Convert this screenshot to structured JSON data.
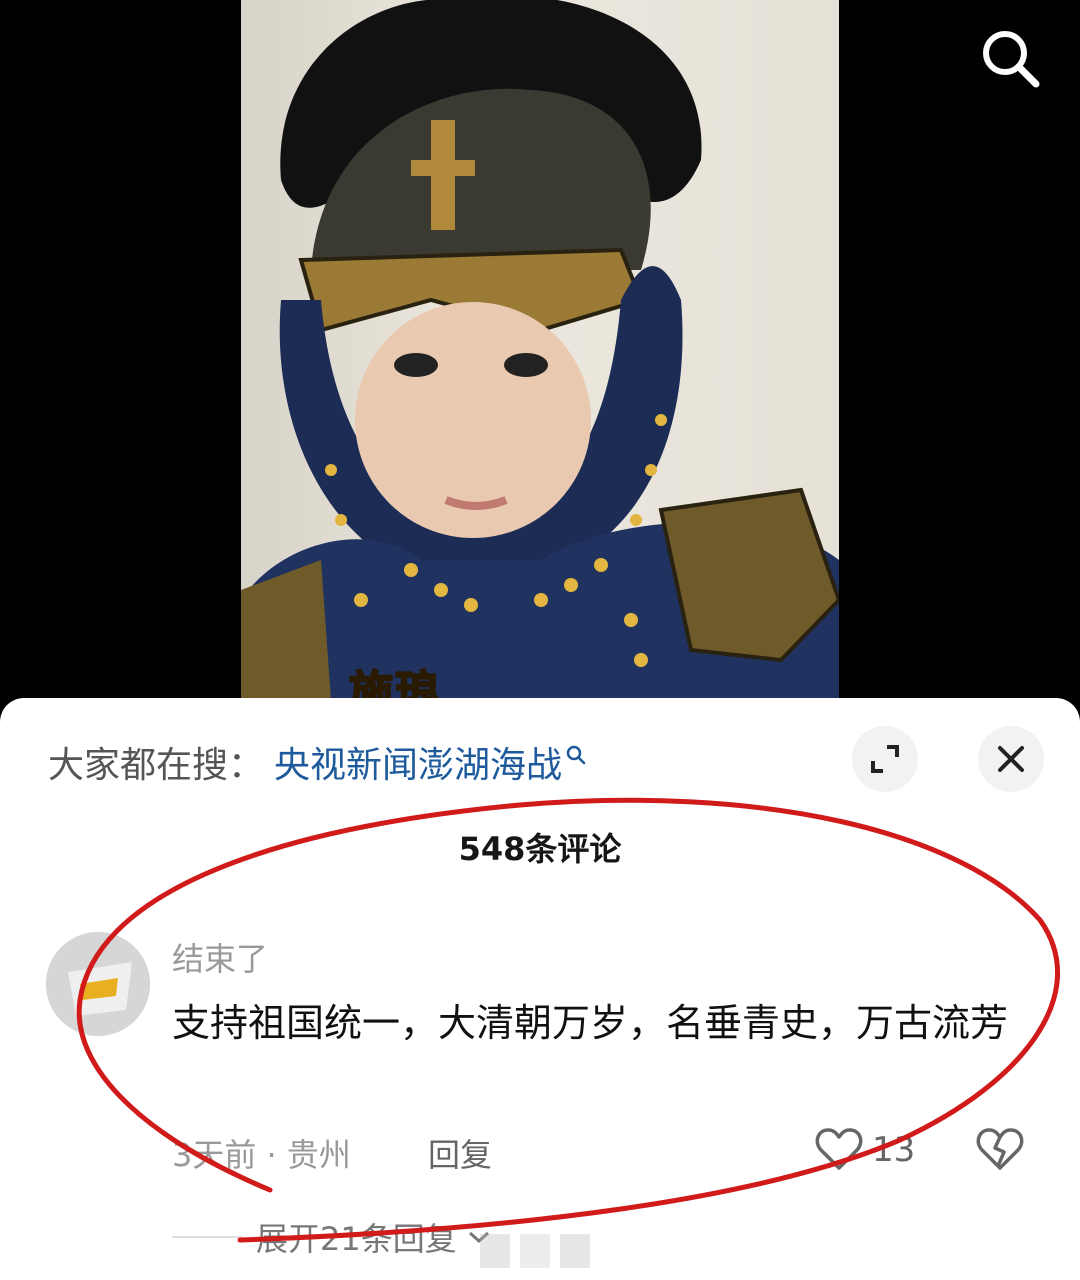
{
  "video": {
    "caption": "施琅",
    "search_icon": "search-icon"
  },
  "suggestion": {
    "label": "大家都在搜：",
    "term": "央视新闻澎湖海战"
  },
  "comments_header": {
    "count_label": "548条评论"
  },
  "comment": {
    "username": "结束了",
    "text": "支持祖国统一，大清朝万岁，名垂青史，万古流芳",
    "time_location": "3天前 · 贵州",
    "reply_label": "回复",
    "like_count": "13",
    "expand_replies": "展开21条回复"
  },
  "colors": {
    "link": "#1e5a9c",
    "annotation": "#d11a1a"
  }
}
